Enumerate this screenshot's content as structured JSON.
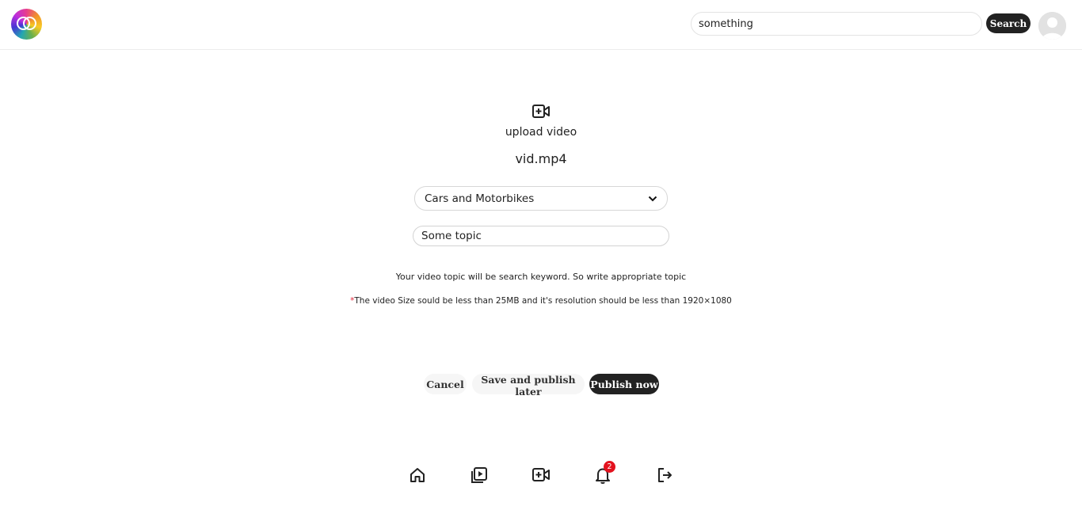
{
  "header": {
    "logo_icon": "intertwined-rings-logo",
    "search": {
      "value": "something",
      "button_label": "Search"
    },
    "avatar_icon": "default-user-avatar"
  },
  "upload": {
    "icon": "video-plus-icon",
    "label": "upload video",
    "file_name": "vid.mp4",
    "category": {
      "selected": "Cars and Motorbikes"
    },
    "topic": {
      "value": "Some topic"
    },
    "hint": "Your video topic will be search keyword. So write appropriate topic",
    "size_note": {
      "asterisk": "*",
      "text": "The video Size sould be less than 25MB and it's resolution should be less than 1920×1080"
    }
  },
  "actions": {
    "cancel_label": "Cancel",
    "later_label": "Save and publish later",
    "publish_label": "Publish now"
  },
  "bottom_nav": {
    "items": [
      "home-icon",
      "video-library-icon",
      "video-plus-icon",
      "bell-icon",
      "logout-icon"
    ],
    "notification_count": "2"
  },
  "colors": {
    "primary_button": "#222222",
    "secondary_button": "#f6f6f6",
    "badge": "#e3121e",
    "asterisk": "#e0263a"
  }
}
